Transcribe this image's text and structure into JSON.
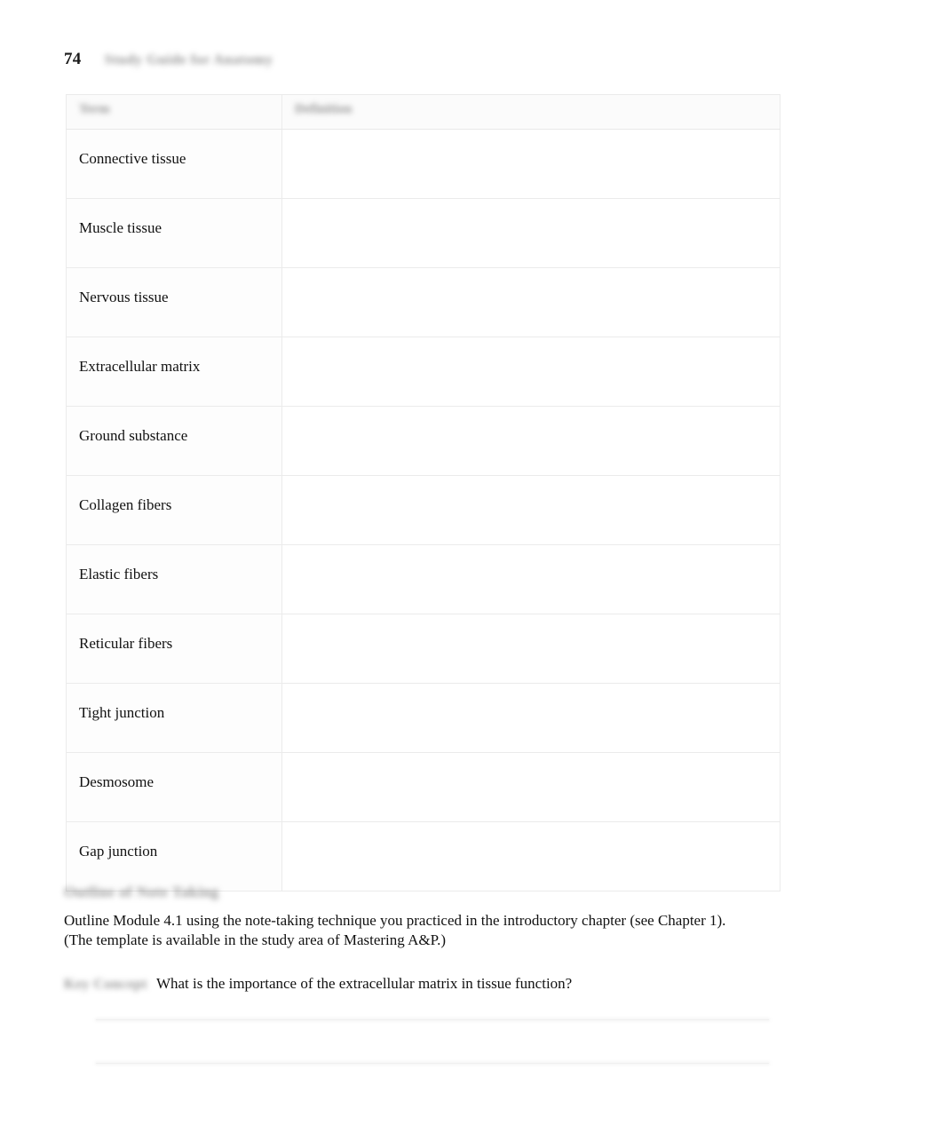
{
  "page": {
    "number": "74",
    "running_head": "Study Guide for Anatomy"
  },
  "table": {
    "headers": {
      "term": "Term",
      "definition": "Definition"
    },
    "rows": [
      {
        "term": "Connective tissue",
        "definition": ""
      },
      {
        "term": "Muscle tissue",
        "definition": ""
      },
      {
        "term": "Nervous tissue",
        "definition": ""
      },
      {
        "term": "Extracellular matrix",
        "definition": ""
      },
      {
        "term": "Ground substance",
        "definition": ""
      },
      {
        "term": "Collagen fibers",
        "definition": ""
      },
      {
        "term": "Elastic fibers",
        "definition": ""
      },
      {
        "term": "Reticular fibers",
        "definition": ""
      },
      {
        "term": "Tight junction",
        "definition": ""
      },
      {
        "term": "Desmosome",
        "definition": ""
      },
      {
        "term": "Gap junction",
        "definition": ""
      }
    ]
  },
  "notetaking": {
    "heading": "Outline of Note Taking",
    "line1": "Outline Module 4.1 using the note-taking technique you practiced in the introductory chapter (see Chapter 1).",
    "line2": "(The template is available in the study area of Mastering A&P.)"
  },
  "keyconcept": {
    "label": "Key Concept",
    "question": "What is the importance of the extracellular matrix in tissue function?",
    "answer_lines": [
      "",
      ""
    ]
  }
}
